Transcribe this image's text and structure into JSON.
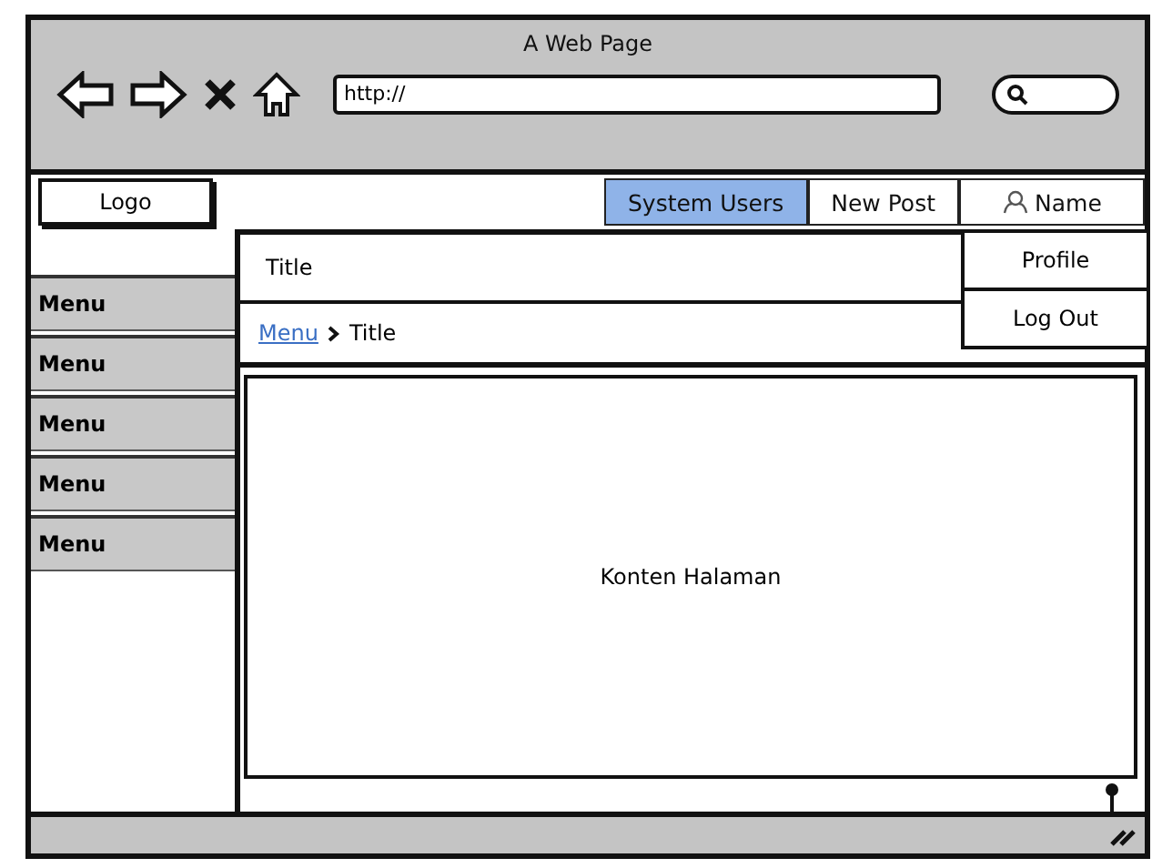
{
  "browser": {
    "title": "A Web Page",
    "address": "http://"
  },
  "nav": {
    "logo": "Logo",
    "tabs": [
      {
        "label": "System Users",
        "selected": true
      },
      {
        "label": "New Post",
        "selected": false
      }
    ],
    "user": "Name"
  },
  "user_menu": {
    "items": [
      "Profile",
      "Log Out"
    ]
  },
  "sidebar": {
    "items": [
      "Menu",
      "Menu",
      "Menu",
      "Menu",
      "Menu"
    ]
  },
  "page": {
    "title": "Title",
    "breadcrumb": {
      "link": "Menu",
      "current": "Title"
    },
    "content": "Konten Halaman"
  }
}
